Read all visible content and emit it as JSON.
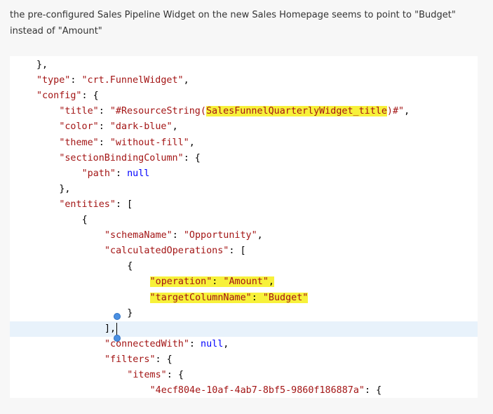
{
  "intro": {
    "text": "the pre-configured Sales Pipeline Widget on the new Sales Homepage seems to point to \"Budget\" instead of \"Amount\""
  },
  "code": {
    "lines": [
      {
        "indent": "",
        "parts": [
          {
            "t": "},",
            "c": "punc"
          }
        ]
      },
      {
        "indent": "",
        "parts": [
          {
            "t": "\"type\"",
            "c": "prop"
          },
          {
            "t": ": ",
            "c": "punc"
          },
          {
            "t": "\"crt.FunnelWidget\"",
            "c": "str"
          },
          {
            "t": ",",
            "c": "punc"
          }
        ]
      },
      {
        "indent": "",
        "parts": [
          {
            "t": "\"config\"",
            "c": "prop"
          },
          {
            "t": ": {",
            "c": "punc"
          }
        ]
      },
      {
        "indent": "    ",
        "parts": [
          {
            "t": "\"title\"",
            "c": "prop"
          },
          {
            "t": ": ",
            "c": "punc"
          },
          {
            "t": "\"#ResourceString(",
            "c": "str"
          },
          {
            "t": "SalesFunnelQuarterlyWidget_title",
            "c": "str",
            "hl": true
          },
          {
            "t": ")#\"",
            "c": "str"
          },
          {
            "t": ",",
            "c": "punc"
          }
        ]
      },
      {
        "indent": "    ",
        "parts": [
          {
            "t": "\"color\"",
            "c": "prop"
          },
          {
            "t": ": ",
            "c": "punc"
          },
          {
            "t": "\"dark-blue\"",
            "c": "str"
          },
          {
            "t": ",",
            "c": "punc"
          }
        ]
      },
      {
        "indent": "    ",
        "parts": [
          {
            "t": "\"theme\"",
            "c": "prop"
          },
          {
            "t": ": ",
            "c": "punc"
          },
          {
            "t": "\"without-fill\"",
            "c": "str"
          },
          {
            "t": ",",
            "c": "punc"
          }
        ]
      },
      {
        "indent": "    ",
        "parts": [
          {
            "t": "\"sectionBindingColumn\"",
            "c": "prop"
          },
          {
            "t": ": {",
            "c": "punc"
          }
        ]
      },
      {
        "indent": "        ",
        "parts": [
          {
            "t": "\"path\"",
            "c": "prop"
          },
          {
            "t": ": ",
            "c": "punc"
          },
          {
            "t": "null",
            "c": "kw"
          }
        ]
      },
      {
        "indent": "    ",
        "parts": [
          {
            "t": "},",
            "c": "punc"
          }
        ]
      },
      {
        "indent": "    ",
        "parts": [
          {
            "t": "\"entities\"",
            "c": "prop"
          },
          {
            "t": ": [",
            "c": "punc"
          }
        ]
      },
      {
        "indent": "        ",
        "parts": [
          {
            "t": "{",
            "c": "punc"
          }
        ]
      },
      {
        "indent": "            ",
        "parts": [
          {
            "t": "\"schemaName\"",
            "c": "prop"
          },
          {
            "t": ": ",
            "c": "punc"
          },
          {
            "t": "\"Opportunity\"",
            "c": "str"
          },
          {
            "t": ",",
            "c": "punc"
          }
        ]
      },
      {
        "indent": "            ",
        "parts": [
          {
            "t": "\"calculatedOperations\"",
            "c": "prop"
          },
          {
            "t": ": [",
            "c": "punc"
          }
        ]
      },
      {
        "indent": "                ",
        "parts": [
          {
            "t": "{",
            "c": "punc"
          }
        ]
      },
      {
        "indent": "                    ",
        "hlLine": true,
        "parts": [
          {
            "t": "\"operation\"",
            "c": "prop"
          },
          {
            "t": ": ",
            "c": "punc"
          },
          {
            "t": "\"Amount\"",
            "c": "str"
          },
          {
            "t": ",",
            "c": "punc"
          }
        ]
      },
      {
        "indent": "                    ",
        "hlLine": true,
        "parts": [
          {
            "t": "\"targetColumnName\"",
            "c": "prop"
          },
          {
            "t": ": ",
            "c": "punc"
          },
          {
            "t": "\"Budget\"",
            "c": "str"
          }
        ]
      },
      {
        "indent": "                ",
        "parts": [
          {
            "t": "}",
            "c": "punc"
          }
        ]
      },
      {
        "indent": "            ",
        "current": true,
        "parts": [
          {
            "t": "],",
            "c": "punc"
          }
        ]
      },
      {
        "indent": "            ",
        "parts": [
          {
            "t": "\"connectedWith\"",
            "c": "prop"
          },
          {
            "t": ": ",
            "c": "punc"
          },
          {
            "t": "null",
            "c": "kw"
          },
          {
            "t": ",",
            "c": "punc"
          }
        ]
      },
      {
        "indent": "            ",
        "parts": [
          {
            "t": "\"filters\"",
            "c": "prop"
          },
          {
            "t": ": {",
            "c": "punc"
          }
        ]
      },
      {
        "indent": "                ",
        "parts": [
          {
            "t": "\"items\"",
            "c": "prop"
          },
          {
            "t": ": {",
            "c": "punc"
          }
        ]
      },
      {
        "indent": "                    ",
        "parts": [
          {
            "t": "\"4ecf804e-10af-4ab7-8bf5-9860f186887a\"",
            "c": "str"
          },
          {
            "t": ": {",
            "c": "punc"
          }
        ]
      }
    ]
  }
}
